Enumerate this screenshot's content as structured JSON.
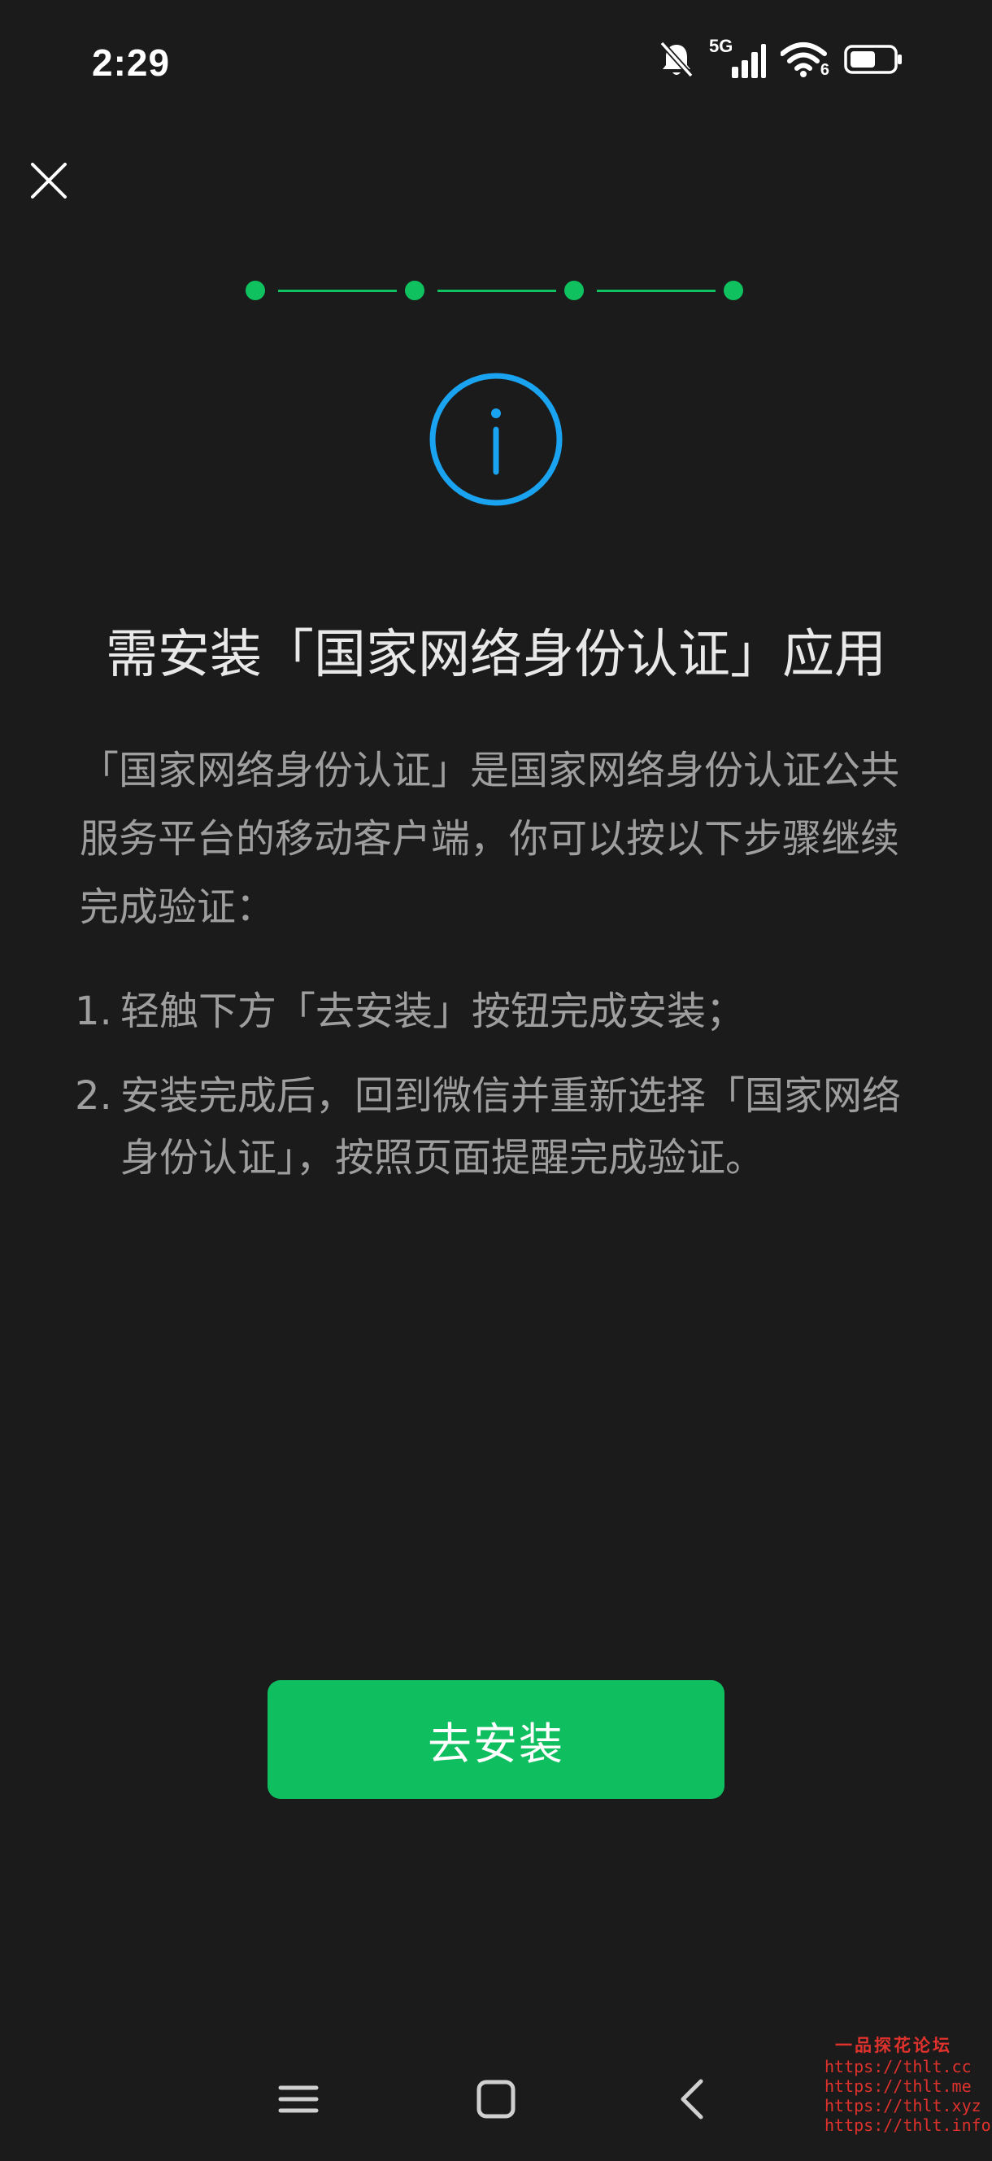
{
  "status_bar": {
    "time": "2:29",
    "network_label": "5G",
    "wifi_label": "6",
    "icons": [
      "bell-muted-icon",
      "signal-5g-icon",
      "wifi-6-icon",
      "battery-icon"
    ]
  },
  "header": {
    "close_icon": "close-icon"
  },
  "progress": {
    "total_steps": 4,
    "current_step": 4,
    "color": "#10c15f"
  },
  "info_icon": {
    "name": "info-circle-icon",
    "color": "#1aa3f0"
  },
  "title": "需安装「国家网络身份认证」应用",
  "description": "「国家网络身份认证」是国家网络身份认证公共服务平台的移动客户端，你可以按以下步骤继续完成验证：",
  "steps": [
    {
      "num": "1.",
      "text": "轻触下方「去安装」按钮完成安装；"
    },
    {
      "num": "2.",
      "text": "安装完成后，回到微信并重新选择「国家网络身份认证」，按照页面提醒完成验证。"
    }
  ],
  "primary_button": {
    "label": "去安装",
    "color": "#0fbf5f"
  },
  "nav_bar": {
    "icons": [
      "menu-icon",
      "home-square-icon",
      "back-chevron-icon"
    ]
  },
  "watermark": {
    "title": "一品探花论坛",
    "lines": [
      "https://thlt.cc",
      "https://thlt.me",
      "https://thlt.xyz",
      "https://thlt.info"
    ],
    "color": "#e0322c"
  }
}
